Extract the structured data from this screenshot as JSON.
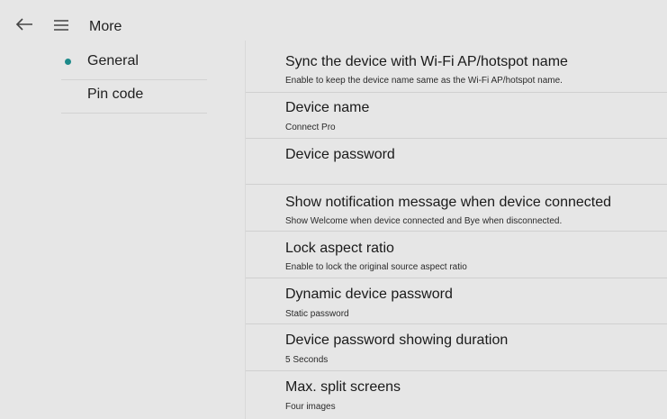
{
  "header": {
    "title": "More",
    "back_icon": "arrow-left-icon",
    "menu_icon": "hamburger-icon"
  },
  "sidebar": {
    "accent_color": "#1d8a8a",
    "items": [
      {
        "label": "General",
        "selected": true
      },
      {
        "label": "Pin code",
        "selected": false
      }
    ]
  },
  "settings": [
    {
      "title": "Sync the device with Wi-Fi AP/hotspot name",
      "subtitle": "Enable to keep the device name same as the Wi-Fi AP/hotspot name."
    },
    {
      "title": "Device name",
      "subtitle": "Connect Pro"
    },
    {
      "title": "Device password",
      "subtitle": ""
    },
    {
      "title": "Show notification message when device connected",
      "subtitle": "Show Welcome when device connected and Bye when disconnected."
    },
    {
      "title": "Lock aspect ratio",
      "subtitle": "Enable to lock the original source aspect ratio"
    },
    {
      "title": "Dynamic device password",
      "subtitle": "Static password"
    },
    {
      "title": "Device password showing duration",
      "subtitle": "5 Seconds"
    },
    {
      "title": "Max. split screens",
      "subtitle": "Four images"
    }
  ]
}
